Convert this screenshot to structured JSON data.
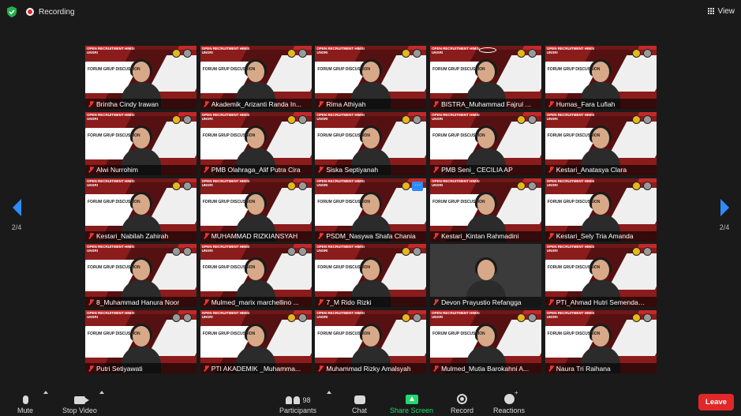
{
  "topbar": {
    "recording_label": "Recording",
    "view_label": "View"
  },
  "pagination": {
    "left_label": "2/4",
    "right_label": "2/4"
  },
  "tile_header": "OPEN RECRUITMENT HIMSI UNSRI",
  "tile_forum": "FORUM GRUP DISCUSSION",
  "participants": [
    {
      "name": "Brintha Cindy Irawan"
    },
    {
      "name": "Akademik_Arizanti Randa In..."
    },
    {
      "name": "Rima Athiyah"
    },
    {
      "name": "BISTRA_Muhammad Fajrul A..."
    },
    {
      "name": "Humas_Fara Lufiah"
    },
    {
      "name": "Alwi Nurrohim"
    },
    {
      "name": "PMB Olahraga_Alif Putra Cira"
    },
    {
      "name": "Siska Septiyanah"
    },
    {
      "name": "PMB Seni_ CECILIA AP"
    },
    {
      "name": "Kestari_Anatasya Clara"
    },
    {
      "name": "Kestari_Nabilah Zahirah"
    },
    {
      "name": "MUHAMMAD RIZKIANSYAH"
    },
    {
      "name": "PSDM_Nasywa Shafa Chania"
    },
    {
      "name": "Kestari_Kintan Rahmadini"
    },
    {
      "name": "Kestari_Sely Tria Amanda"
    },
    {
      "name": "8_Muhammad Hanura Noor"
    },
    {
      "name": "Mulmed_marix marchellino ..."
    },
    {
      "name": "7_M Rido Rizki"
    },
    {
      "name": "Devon Prayustio Refangga"
    },
    {
      "name": "PTI_Ahmad Hutri Semendaw..."
    },
    {
      "name": "Putri Setiyawati"
    },
    {
      "name": "PTI AKADEMIK _Muhamma..."
    },
    {
      "name": "Muhammad Rizky Amalsyah"
    },
    {
      "name": "Mulmed_Mutia Barokahni A..."
    },
    {
      "name": "Naura Tri Raihana"
    }
  ],
  "toolbar": {
    "mute_label": "Mute",
    "video_label": "Stop Video",
    "participants_label": "Participants",
    "participants_count": "98",
    "chat_label": "Chat",
    "share_label": "Share Screen",
    "record_label": "Record",
    "reactions_label": "Reactions",
    "leave_label": "Leave"
  },
  "colors": {
    "accent_blue": "#2d8cff",
    "share_green": "#23d96c",
    "leave_red": "#e02828",
    "tile_red": "#8b1c1c"
  }
}
